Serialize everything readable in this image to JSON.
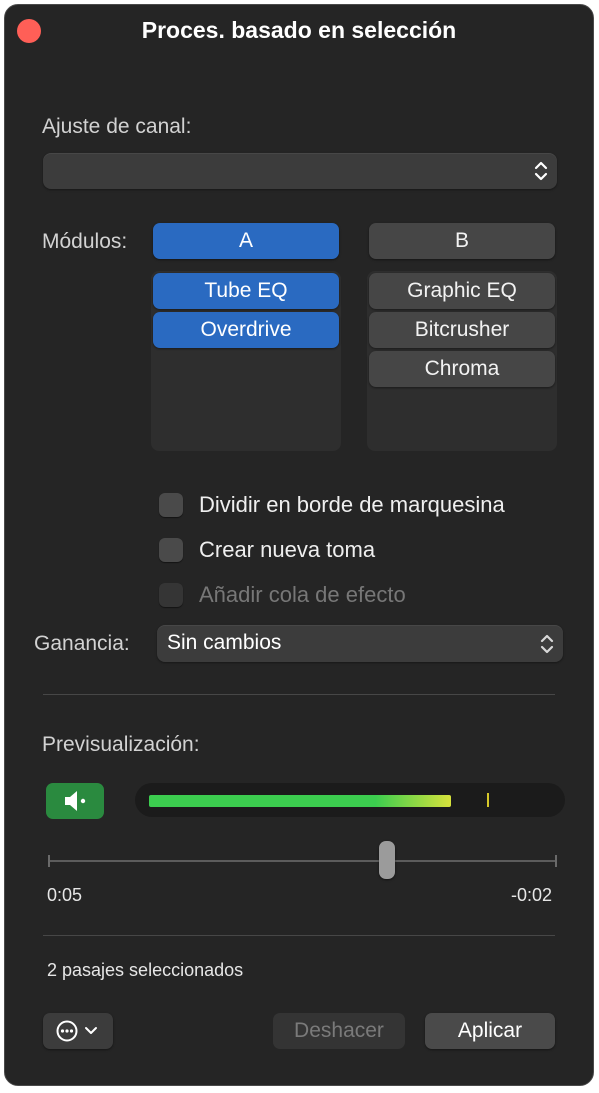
{
  "window": {
    "title": "Proces. basado en selección"
  },
  "channel_strip": {
    "label": "Ajuste de canal:",
    "value": ""
  },
  "modules": {
    "label": "Módulos:",
    "column_a": {
      "header": "A",
      "items": [
        "Tube EQ",
        "Overdrive"
      ]
    },
    "column_b": {
      "header": "B",
      "items": [
        "Graphic EQ",
        "Bitcrusher",
        "Chroma"
      ]
    }
  },
  "options": [
    {
      "label": "Dividir en borde de marquesina",
      "checked": false,
      "enabled": true
    },
    {
      "label": "Crear nueva toma",
      "checked": false,
      "enabled": true
    },
    {
      "label": "Añadir cola de efecto",
      "checked": false,
      "enabled": false
    }
  ],
  "gain": {
    "label": "Ganancia:",
    "value": "Sin cambios"
  },
  "preview": {
    "label": "Previsualización:",
    "level_fraction": 0.755,
    "peak_fraction": 0.845,
    "position_fraction": 0.665,
    "elapsed": "0:05",
    "remaining": "-0:02"
  },
  "status": {
    "text": "2 pasajes seleccionados"
  },
  "buttons": {
    "undo": "Deshacer",
    "apply": "Aplicar"
  },
  "colors": {
    "accent_blue": "#2a6ac1",
    "speaker_green": "#2a8a3f",
    "close_red": "#ff5f57",
    "meter_green": "#3ccd4f",
    "meter_yellow": "#d7e23c"
  },
  "icons": {
    "close": "close-icon",
    "popup_arrows": "up-down-chevron-icon",
    "speaker": "speaker-icon",
    "more": "ellipsis-circle-icon",
    "chevron": "chevron-down-icon"
  }
}
